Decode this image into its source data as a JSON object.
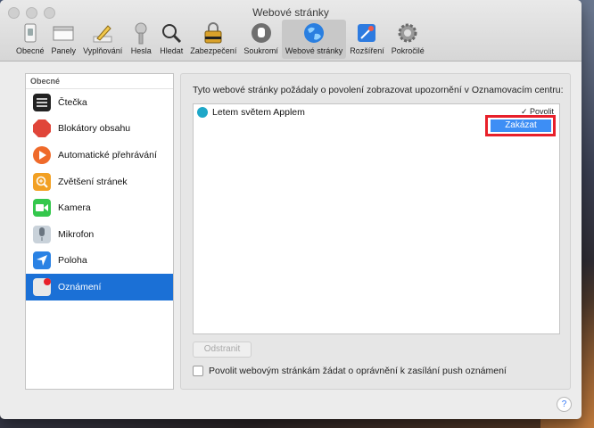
{
  "window": {
    "title": "Webové stránky"
  },
  "toolbar": {
    "items": [
      {
        "label": "Obecné",
        "icon": "general-switch-icon"
      },
      {
        "label": "Panely",
        "icon": "tabs-icon"
      },
      {
        "label": "Vyplňování",
        "icon": "pencil-icon"
      },
      {
        "label": "Hesla",
        "icon": "key-icon"
      },
      {
        "label": "Hledat",
        "icon": "magnifier-icon"
      },
      {
        "label": "Zabezpečení",
        "icon": "lock-icon"
      },
      {
        "label": "Soukromí",
        "icon": "hand-icon"
      },
      {
        "label": "Webové stránky",
        "icon": "globe-icon",
        "active": true
      },
      {
        "label": "Rozšíření",
        "icon": "extensions-icon"
      },
      {
        "label": "Pokročilé",
        "icon": "gear-icon"
      }
    ]
  },
  "sidebar": {
    "header": "Obecné",
    "items": [
      {
        "label": "Čtečka",
        "icon": "reader-icon",
        "color": "#222222"
      },
      {
        "label": "Blokátory obsahu",
        "icon": "stop-icon",
        "color": "#e0453a"
      },
      {
        "label": "Automatické přehrávání",
        "icon": "play-icon",
        "color": "#ef6a2a"
      },
      {
        "label": "Zvětšení stránek",
        "icon": "zoom-icon",
        "color": "#f2a023"
      },
      {
        "label": "Kamera",
        "icon": "camera-icon",
        "color": "#34c74c"
      },
      {
        "label": "Mikrofon",
        "icon": "microphone-icon",
        "color": "#c9d2da"
      },
      {
        "label": "Poloha",
        "icon": "location-icon",
        "color": "#2a82e4"
      },
      {
        "label": "Oznámení",
        "icon": "notifications-icon",
        "color": "#e8e8e8",
        "selected": true
      }
    ]
  },
  "content": {
    "description": "Tyto webové stránky požádaly o povolení zobrazovat upozornění v Oznamovacím centru:",
    "site": "Letem světem Applem",
    "dropdown_value": "✓ Povolit",
    "menu_option": "Zakázat",
    "remove_label": "Odstranit",
    "push_label": "Povolit webovým stránkám žádat o oprávnění k zasílání push oznámení"
  },
  "help": "?",
  "colors": {
    "selection": "#1b70d6",
    "highlight": "#e8202a",
    "menu": "#3d8ef5"
  }
}
